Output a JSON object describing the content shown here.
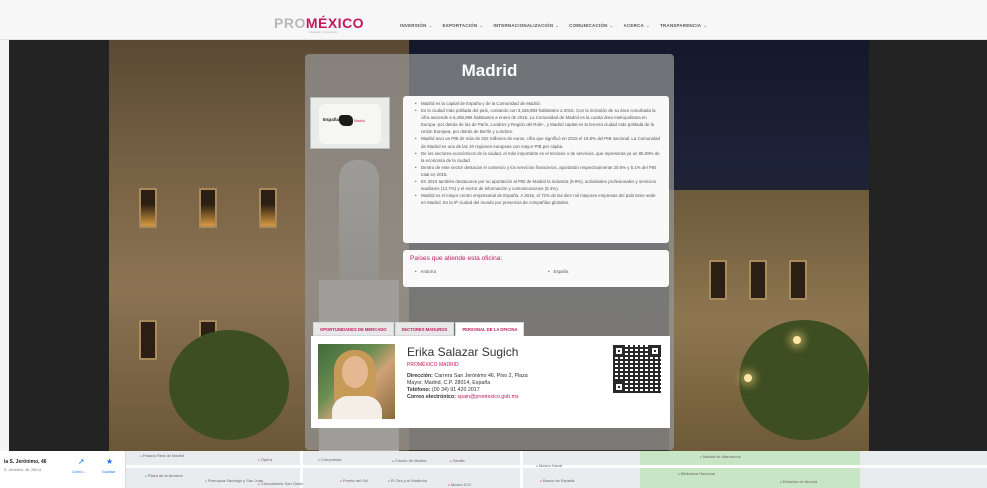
{
  "header": {
    "logo_pro": "PRO",
    "logo_mx": "MÉXICO",
    "logo_sub": "Inversión y Comercio",
    "nav": [
      "INVERSIÓN",
      "EXPORTACIÓN",
      "INTERNACIONALIZACIÓN",
      "COMUNICACIÓN",
      "ACERCA",
      "TRANSPARENCIA"
    ]
  },
  "office": {
    "title": "Madrid",
    "map_label_country": "España",
    "map_label_city": "Madrid",
    "bullets": [
      "Madrid es la capital de España y de la Comunidad de Madrid.",
      "Es la ciudad más poblada del país, contando con 3,165,883 habitantes a 2016. Con la inclusión de su área conurbada la cifra asciende a 6,466,996 habitantes a enero de 2016. La Comunidad de Madrid es la cuarta área metropolitana en Europa -por detrás de las de París, Londres y Región del Ruhr-, y Madrid capital es la tercera ciudad más poblada de la Unión Europea, por detrás de Berlín y Londres.",
      "Madrid tuvo un PIB de más de 202 millones de euros, cifra que significó en 2015 el 18.8% del PIB nacional. La Comunidad de Madrid es una de las 10 regiones europeas con mayor PIB per cápita.",
      "De los sectores económicos de la ciudad, el más importante es el terciario o de servicios, que representa ya un 85.09% de la economía de la ciudad.",
      "Dentro de este sector destacan el comercio y los servicios financieros, aportando respectivamente 20.6% y 5.1% del PIB total en 2015.",
      "En 2015 también destacaron por su aportación al PIB de Madrid la industria (9.9%), actividades profesionales y servicios auxiliares (13.7%) y el sector de información y comunicaciones (9.4%).",
      "Madrid es el mayor centro empresarial de España. A 2016, el 72% de las diez mil mayores empresas del país tiene sede en Madrid. Es la 9ª ciudad del mundo por presencia de compañías globales."
    ],
    "countries_title": "Países que atiende esta oficina:",
    "countries": [
      "Andorra",
      "España"
    ]
  },
  "tabs": [
    "OPORTUNIDADES DE MERCADO",
    "SECTORES MADUROS",
    "PERSONAL DE LA OFICINA"
  ],
  "contact": {
    "name": "Erika Salazar Sugich",
    "office": "PROMÉXICO MADRID",
    "address_label": "Dirección:",
    "address_1": "Carrera San Jerónimo 46, Piso 2, Plaza",
    "address_2": "Mayor, Madrid, C.P. 28014, España",
    "phone_label": "Teléfono:",
    "phone": "(00 34) 91 420 2017",
    "email_label": "Correo electrónico:",
    "email": "spain@promexico.gob.mx"
  },
  "map": {
    "address": "la S. Jerónimo, 46",
    "address_sub": "S. Jerónimo, 46, 28014",
    "directions_label": "Cómo l...",
    "save_label": "Guardar",
    "pois": [
      "Palacio Real de Madrid",
      "Plaza de la Armería",
      "Parroquia Santiago y San Juan",
      "Ópera",
      "Chocolatería San Ginés",
      "Puerta del Sol",
      "Corrymedia",
      "El Oso y el Madroño",
      "Círculo de Madrid",
      "Sevilla",
      "Museo ICO",
      "Museo Naval",
      "Banco de España",
      "Madrid de Marruecos",
      "Biblioteca Nacional",
      "Estación de Atocha"
    ]
  }
}
